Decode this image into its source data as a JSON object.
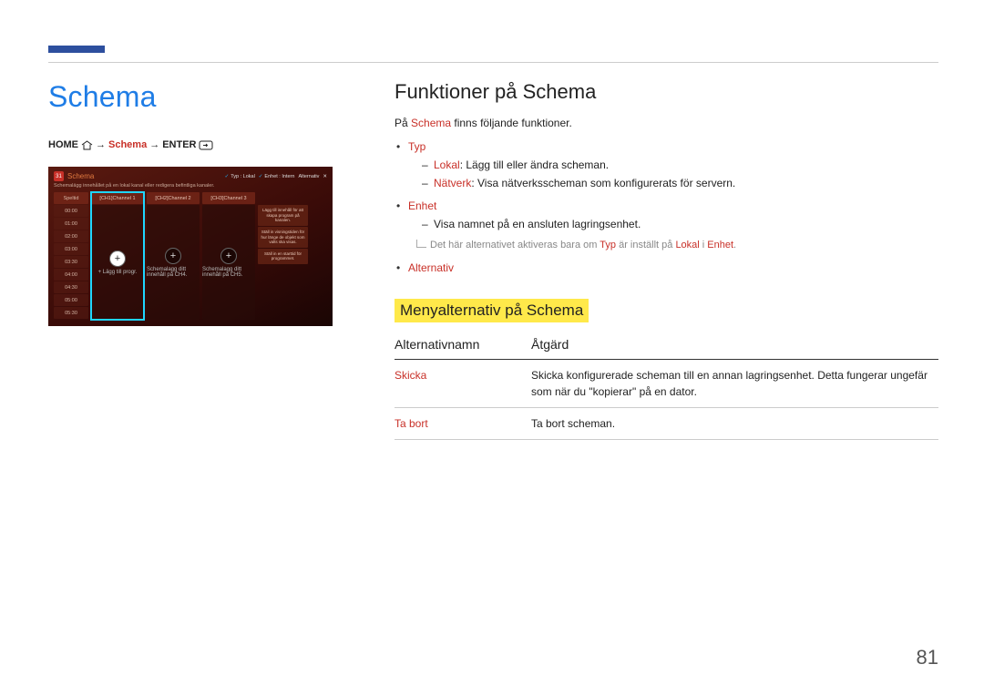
{
  "page_number": "81",
  "left": {
    "title": "Schema",
    "breadcrumb": {
      "home": "HOME",
      "schema": "Schema",
      "enter": "ENTER"
    },
    "screenshot": {
      "title": "Schema",
      "cal": "31",
      "header_tags": {
        "typ_label": "Typ :",
        "typ_val": "Lokal",
        "enhet_label": "Enhet :",
        "enhet_val": "Intern",
        "alt": "Alternativ"
      },
      "subtitle": "Schemalägg innehållet på en lokal kanal eller redigera befintliga kanaler.",
      "times_header": "Speltid",
      "times": [
        "00:00",
        "01:00",
        "02:00",
        "03:00",
        "03:30",
        "04:00",
        "04:30",
        "05:00",
        "05:30"
      ],
      "channels": [
        {
          "header": "[CH1]Channel 1",
          "caption": "+ Lägg till progr.",
          "highlight": true
        },
        {
          "header": "[CH2]Channel 2",
          "caption": "Schemalagg ditt innehåll på CH4.",
          "highlight": false
        },
        {
          "header": "[CH3]Channel 3",
          "caption": "Schemalagg ditt innehåll på CH5.",
          "highlight": false
        }
      ],
      "side_boxes": [
        "Lägg till innehåll för att skapa program på kanalen.",
        "Ställ in visningstiden för hur länge de objekt som valts ska visas.",
        "Ställ in en starttid för programmet."
      ]
    }
  },
  "right": {
    "h2": "Funktioner på Schema",
    "intro_pre": "På ",
    "intro_accent": "Schema",
    "intro_post": " finns följande funktioner.",
    "bul_typ": "Typ",
    "sub_lokal_label": "Lokal",
    "sub_lokal_text": ": Lägg till eller ändra scheman.",
    "sub_natverk_label": "Nätverk",
    "sub_natverk_text": ": Visa nätverksscheman som konfigurerats för servern.",
    "bul_enhet": "Enhet",
    "sub_enhet_text": "Visa namnet på en ansluten lagringsenhet.",
    "note_pre": "Det här alternativet aktiveras bara om ",
    "note_a1": "Typ",
    "note_mid": " är inställt på ",
    "note_a2": "Lokal",
    "note_mid2": " i ",
    "note_a3": "Enhet",
    "note_post": ".",
    "bul_alt": "Alternativ",
    "h3": "Menyalternativ på Schema",
    "tbl": {
      "col1": "Alternativnamn",
      "col2": "Åtgärd",
      "rows": [
        {
          "name": "Skicka",
          "desc": "Skicka konfigurerade scheman till en annan lagringsenhet. Detta fungerar ungefär som när du \"kopierar\" på en dator."
        },
        {
          "name": "Ta bort",
          "desc": "Ta bort scheman."
        }
      ]
    }
  }
}
